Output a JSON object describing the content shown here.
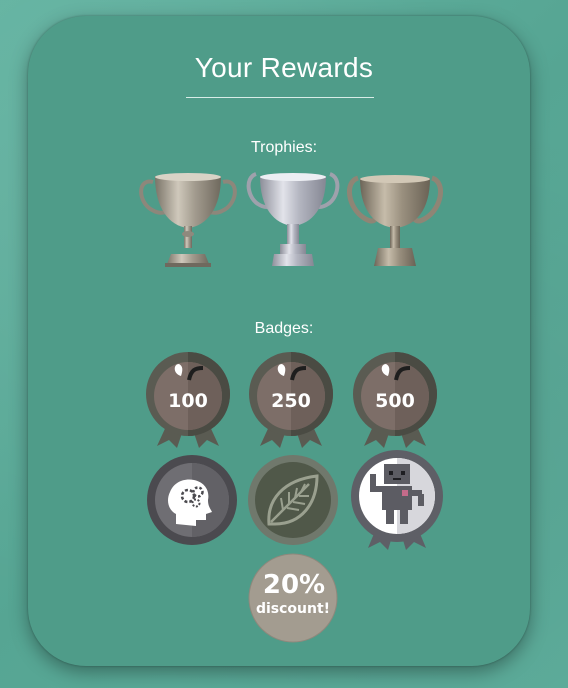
{
  "header": {
    "title": "Your Rewards"
  },
  "sections": {
    "trophies_label": "Trophies:",
    "badges_label": "Badges:"
  },
  "trophies": [
    {
      "icon": "gold-trophy-icon",
      "color": "#a8a195"
    },
    {
      "icon": "silver-trophy-icon",
      "color": "#aeb0bb"
    },
    {
      "icon": "bronze-trophy-icon",
      "color": "#9d9383"
    }
  ],
  "badges": {
    "apple_badges": [
      {
        "icon": "apple-badge-icon",
        "value": "100"
      },
      {
        "icon": "apple-badge-icon",
        "value": "250"
      },
      {
        "icon": "apple-badge-icon",
        "value": "500"
      }
    ],
    "other_badges": [
      {
        "icon": "brain-gears-badge-icon"
      },
      {
        "icon": "leaf-badge-icon"
      },
      {
        "icon": "robot-badge-icon"
      }
    ],
    "discount": {
      "icon": "discount-badge-icon",
      "line1": "20%",
      "line2": "discount!"
    }
  },
  "colors": {
    "background": "#5aaa98",
    "card": "#4f9c89",
    "text": "#ffffff"
  }
}
